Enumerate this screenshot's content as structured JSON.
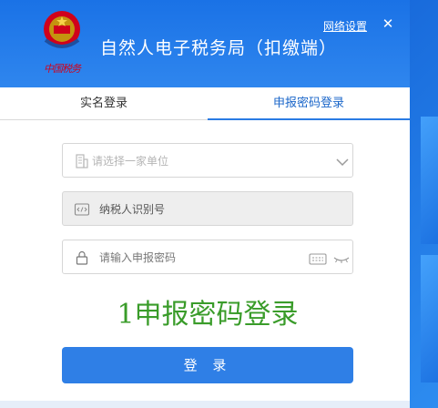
{
  "window": {
    "title": "自然人电子税务局（扣缴端）",
    "emblem_text": "中国税务",
    "network_settings": "网络设置",
    "close_symbol": "✕"
  },
  "tabs": {
    "realname_login": "实名登录",
    "password_login": "申报密码登录",
    "active": "申报密码登录"
  },
  "form": {
    "unit_placeholder": "请选择一家单位",
    "taxpayer_id_label": "纳税人识别号",
    "password_placeholder": "请输入申报密码"
  },
  "caption": "1申报密码登录",
  "login_button": "登 录",
  "colors": {
    "titlebar": "#2f86ee",
    "accent": "#2a7be4",
    "caption_green": "#3a9c2a",
    "emblem_red": "#d0021b"
  }
}
